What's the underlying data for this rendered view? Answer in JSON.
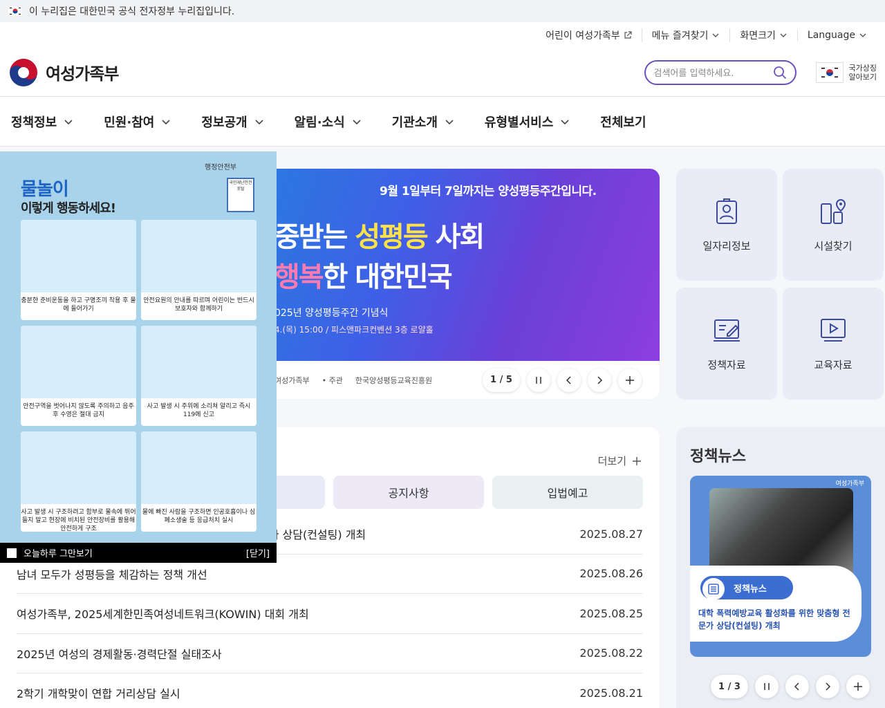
{
  "gov_banner": {
    "text": "이 누리집은 대한민국 공식 전자정부 누리집입니다."
  },
  "util": {
    "kids": "어린이 여성가족부",
    "favorites": "메뉴 즐겨찾기",
    "zoom": "화면크기",
    "language": "Language"
  },
  "header": {
    "logo_text": "여성가족부",
    "search_placeholder": "검색어를 입력하세요.",
    "national_symbol_line1": "국가상징",
    "national_symbol_line2": "알아보기"
  },
  "gnb": [
    "정책정보",
    "민원·참여",
    "정보공개",
    "알림·소식",
    "기관소개",
    "유형별서비스",
    "전체보기"
  ],
  "hero": {
    "top_text": "9월 1일부터 7일까지는 양성평등주간입니다.",
    "line1a": "중받는 ",
    "line1b": "성평등",
    "line1c": " 사회",
    "line2a": "행복",
    "line2b": "한 대한민국",
    "line3": "025년 양성평등주간 기념식",
    "line4": "4.(목) 15:00 / 피스앤파크컨벤션 3층 로얄홀",
    "foot1": "여성가족부",
    "foot2": "• 주관",
    "foot3": "한국양성평등교육진흥원",
    "page": "1 / 5"
  },
  "quick": [
    "일자리정보",
    "시설찾기",
    "정책자료",
    "교육자료"
  ],
  "notice": {
    "more": "더보기",
    "tabs": [
      "",
      "공지사항",
      "입법예고"
    ],
    "rows": [
      {
        "title": "문가 상담(컨설팅) 개최",
        "date": "2025.08.27"
      },
      {
        "title": "남녀 모두가 성평등을 체감하는 정책 개선",
        "date": "2025.08.26"
      },
      {
        "title": "여성가족부, 2025세계한민족여성네트워크(KOWIN) 대회 개최",
        "date": "2025.08.25"
      },
      {
        "title": "2025년 여성의 경제활동·경력단절 실태조사",
        "date": "2025.08.22"
      },
      {
        "title": "2학기 개학맞이 연합 거리상담 실시",
        "date": "2025.08.21"
      }
    ]
  },
  "news": {
    "title": "정책뉴스",
    "badge": "정책뉴스",
    "mini": "여성가족부",
    "card_text": "대학 폭력예방교육 활성화를 위한 맞춤형 전문가 상담(컨설팅) 개최",
    "page": "1 / 3"
  },
  "popup": {
    "ministry": "행정안전부",
    "title": "물놀이",
    "subtitle": "이렇게 행동하세요!",
    "qr": "국민재난안전포털",
    "captions": [
      "충분한 준비운동을 하고 구명조끼 착용 후 물에 들어가기",
      "안전요원의 안내를 따르며 어린이는 반드시 보호자와 함께하기",
      "안전구역을 벗어나지 않도록 주의하고 음주 후 수영은 절대 금지",
      "사고 발생 시 주위에 소리쳐 알리고 즉시 119에 신고",
      "사고 발생 시 구조하려고 함부로 물속에 뛰어 들지 말고 현장에 비치된 안전장비를 활용해 안전하게 구조",
      "물에 빠진 사람을 구조하면 인공호흡이나 심폐소생술 등 응급처치 실시"
    ],
    "hide_today": "오늘하루 그만보기",
    "close": "[닫기]"
  }
}
